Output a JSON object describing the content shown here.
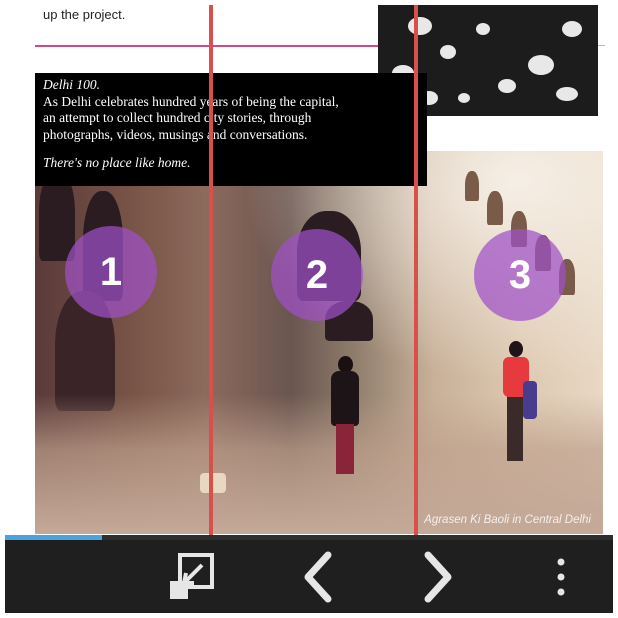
{
  "page": {
    "top_text": "up the project.",
    "caption": {
      "title": "Delhi 100.",
      "body_lines": [
        "As Delhi celebrates hundred years of being the capital,",
        "an attempt to collect hundred city stories, through",
        "photographs, videos, musings and conversations."
      ],
      "tagline": "There's no place like home."
    },
    "photo_credit": "Agrasen Ki Baoli in Central Delhi",
    "steps": [
      "1",
      "2",
      "3"
    ]
  },
  "reader": {
    "progress_fraction": 0.16,
    "progress_color": "#4aa3df",
    "guide_line_color": "#d8504c"
  },
  "toolbar": {
    "fullscreen": {
      "icon": "fullscreen-exit-icon"
    },
    "previous": {
      "icon": "chevron-left-icon"
    },
    "next": {
      "icon": "chevron-right-icon"
    },
    "more": {
      "icon": "more-vertical-icon"
    }
  }
}
